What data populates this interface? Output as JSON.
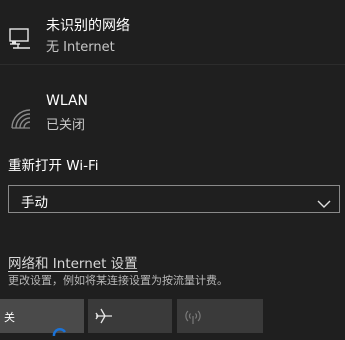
{
  "networks": {
    "ethernet": {
      "name": "未识别的网络",
      "status": "无 Internet",
      "icon": "ethernet-network-icon"
    },
    "wlan": {
      "name": "WLAN",
      "status": "已关闭",
      "icon": "wifi-off-icon"
    }
  },
  "wifi_reopen": {
    "label": "重新打开 Wi-Fi",
    "selected": "手动"
  },
  "settings": {
    "link": "网络和 Internet 设置",
    "description": "更改设置，例如将某连接设置为按流量计费。"
  },
  "quick_actions": {
    "wifi_label": "关",
    "airplane_icon": "airplane-icon",
    "hotspot_icon": "mobile-hotspot-icon"
  },
  "colors": {
    "background": "#1f1f1f",
    "tile": "#3a3a3a",
    "tile_active": "#4a4a4a",
    "accent": "#1a73d9"
  }
}
